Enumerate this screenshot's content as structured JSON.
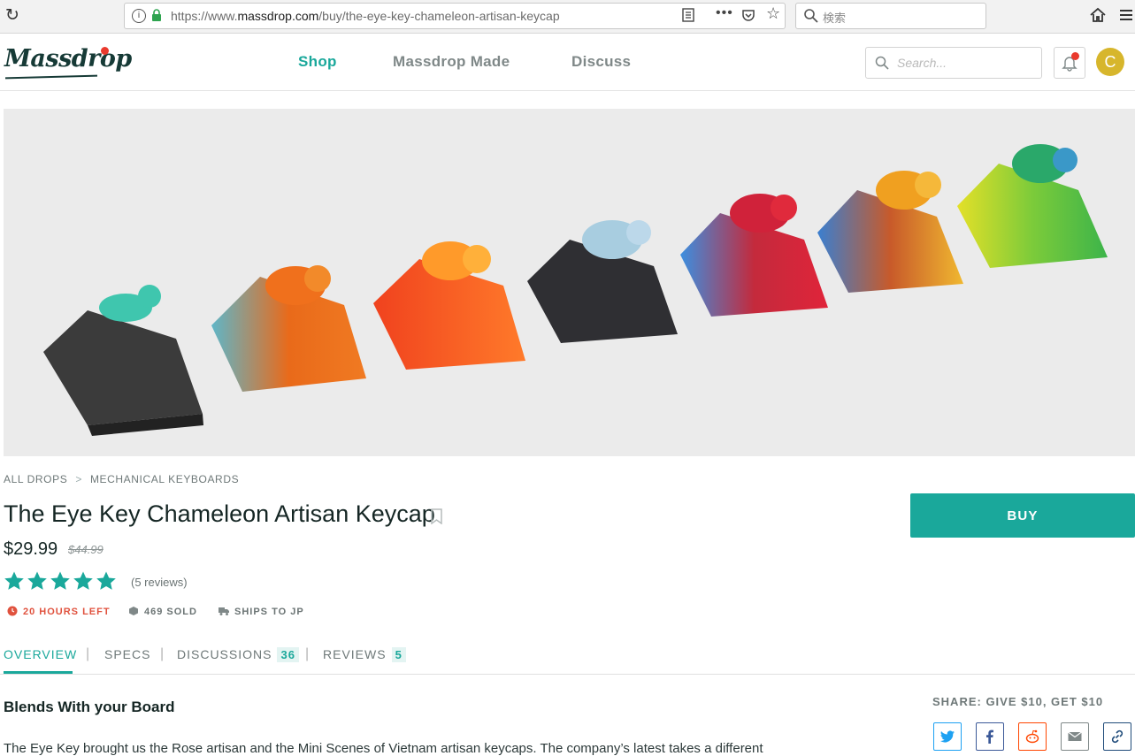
{
  "browser": {
    "url_prefix": "https://www.",
    "url_domain": "massdrop.com",
    "url_path": "/buy/the-eye-key-chameleon-artisan-keycap",
    "search_placeholder": "検索"
  },
  "header": {
    "logo": "Massdrop",
    "nav": [
      "Shop",
      "Massdrop Made",
      "Discuss"
    ],
    "search_placeholder": "Search...",
    "avatar_initial": "C"
  },
  "product": {
    "breadcrumb": [
      "ALL DROPS",
      "MECHANICAL KEYBOARDS"
    ],
    "breadcrumb_sep": ">",
    "title": "The Eye Key Chameleon Artisan Keycap",
    "price": "$29.99",
    "original_price": "$44.99",
    "rating": 5,
    "reviews_text": "(5 reviews)",
    "time_left": "20 HOURS LEFT",
    "sold": "469 SOLD",
    "ships": "SHIPS TO JP",
    "buy_label": "BUY",
    "star_color": "#1aa89b"
  },
  "tabs": [
    {
      "label": "OVERVIEW",
      "count": ""
    },
    {
      "label": "SPECS",
      "count": ""
    },
    {
      "label": "DISCUSSIONS",
      "count": "36"
    },
    {
      "label": "REVIEWS",
      "count": "5"
    }
  ],
  "overview": {
    "heading": "Blends With your Board",
    "text": "The Eye Key brought us the Rose artisan and the Mini Scenes of Vietnam artisan keycaps. The company’s latest takes a different"
  },
  "share": {
    "label": "SHARE: GIVE $10, GET $10",
    "buttons": [
      "twitter",
      "facebook",
      "reddit",
      "email",
      "link"
    ]
  },
  "colors": {
    "accent": "#1aa89b",
    "alert": "#e0523e",
    "brand_dark": "#163a36"
  }
}
